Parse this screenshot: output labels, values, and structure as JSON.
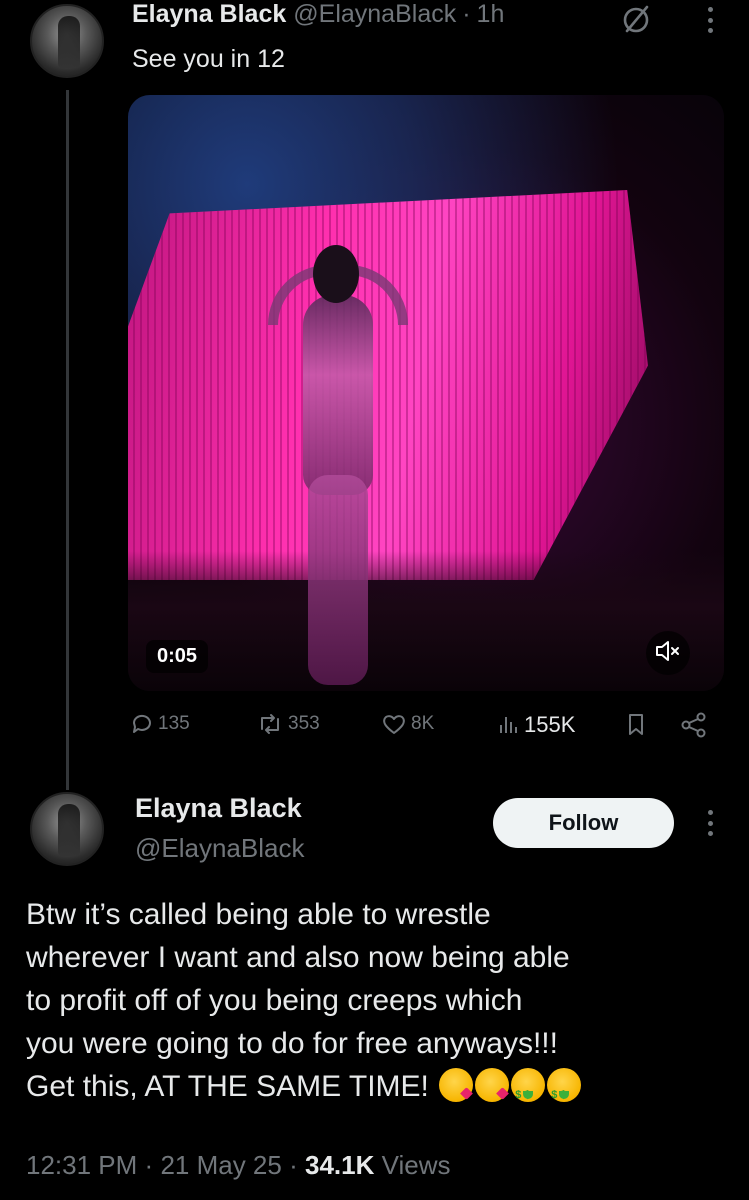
{
  "tweet1": {
    "author_name": "Elayna Black",
    "handle": "@ElaynaBlack",
    "separator": "·",
    "time": "1h",
    "text": "See you in 12",
    "video": {
      "timestamp": "0:05",
      "muted": true
    },
    "stats": {
      "replies": "135",
      "reposts": "353",
      "likes": "8K",
      "views": "155K"
    },
    "icons": [
      "grok-icon",
      "more-icon",
      "reply-icon",
      "repost-icon",
      "like-icon",
      "views-icon",
      "bookmark-icon",
      "share-icon",
      "mute-icon"
    ]
  },
  "tweet2": {
    "author_name": "Elayna Black",
    "handle": "@ElaynaBlack",
    "follow_label": "Follow",
    "body_lines": [
      "Btw it’s called being able to wrestle",
      "wherever I want and also now being able",
      "to profit off of you being creeps which",
      "you were going to do for free anyways!!!",
      "Get this, AT THE SAME TIME!"
    ],
    "emojis": [
      "face-blowing-kiss",
      "face-blowing-kiss",
      "money-mouth-face",
      "money-mouth-face"
    ],
    "meta": {
      "time": "12:31 PM",
      "separator": "·",
      "date": "21 May 25",
      "views_count": "34.1K",
      "views_label": "Views"
    }
  },
  "colors": {
    "background": "#000000",
    "text_primary": "#e7e9ea",
    "text_secondary": "#71767b",
    "follow_button_bg": "#eff3f4",
    "video_accent": "#ff2fae"
  }
}
